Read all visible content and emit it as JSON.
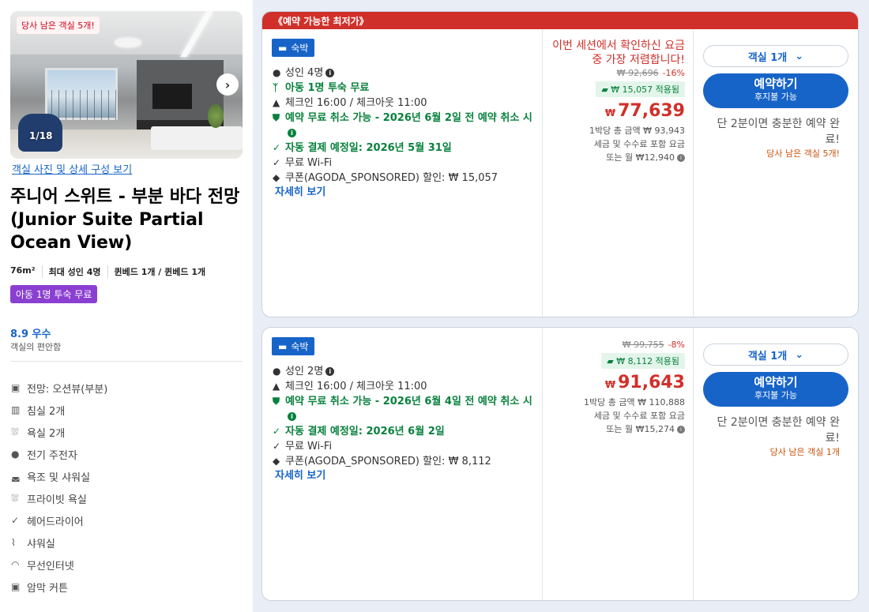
{
  "room": {
    "photo_badge": "당사 남은 객실 5개!",
    "photo_counter": "1/18",
    "gallery_link": "객실 사진 및 상세 구성 보기",
    "title": "주니어 스위트 - 부분 바다 전망 (Junior Suite Partial Ocean View)",
    "specs": [
      "76m²",
      "최대 성인 4명",
      "퀸베드 1개 / 퀸베드 1개"
    ],
    "promo_tag": "아동 1명 투숙 무료",
    "rating_score": "8.9 우수",
    "rating_sub": "객실의 편안함",
    "features": [
      {
        "icon": "view-icon",
        "glyph": "▣",
        "label": "전망: 오션뷰(부분)"
      },
      {
        "icon": "bedroom-icon",
        "glyph": "▥",
        "label": "침실 2개"
      },
      {
        "icon": "bath-icon",
        "glyph": "⛆",
        "label": "욕실 2개"
      },
      {
        "icon": "kettle-icon",
        "glyph": "●",
        "label": "전기 주전자"
      },
      {
        "icon": "bathtub-icon",
        "glyph": "◛",
        "label": "욕조 및 샤워실"
      },
      {
        "icon": "private-bath-icon",
        "glyph": "⛆",
        "label": "프라이빗 욕실"
      },
      {
        "icon": "check-icon",
        "glyph": "✓",
        "label": "헤어드라이어"
      },
      {
        "icon": "shower-icon",
        "glyph": "⌇",
        "label": "샤워실"
      },
      {
        "icon": "wifi-icon",
        "glyph": "◠",
        "label": "무선인터넷"
      },
      {
        "icon": "blackout-icon",
        "glyph": "▣",
        "label": "암막 커튼"
      }
    ]
  },
  "offers": [
    {
      "banner": "《예약 가능한 최저가》",
      "stay_tag": "숙박",
      "occupancy": "성인 4명",
      "kids_free": "아동 1명 투숙 무료",
      "checkin": "체크인 16:00 / 체크아웃 11:00",
      "cancel": "예약 무료 취소 가능 - 2026년 6월 2일 전 예약 취소 시",
      "autopay": "자동 결제 예정일: 2026년 5월 31일",
      "wifi": "무료 Wi-Fi",
      "coupon": "쿠폰(AGODA_SPONSORED) 할인: ₩ 15,057",
      "detail_link": "자세히 보기",
      "lowest_msg": "이번 세션에서 확인하신 요금 중 가장 저렴합니다!",
      "original_price": "₩ 92,696",
      "discount": "-16%",
      "coupon_applied": "₩ 15,057 적용됨",
      "currency": "₩",
      "price": "77,639",
      "night_total": "1박당 총 금액 ₩ 93,943",
      "tax_note": "세금 및 수수료 포함 요금",
      "monthly": "또는 월 ₩12,940",
      "room_select": "객실 1개",
      "book_label": "예약하기",
      "pay_later": "후지불 가능",
      "quick_msg": "단 2분이면 충분한 예약 완료!",
      "rooms_left": "당사 남은 객실 5개!"
    },
    {
      "stay_tag": "숙박",
      "occupancy": "성인 2명",
      "checkin": "체크인 16:00 / 체크아웃 11:00",
      "cancel": "예약 무료 취소 가능 - 2026년 6월 4일 전 예약 취소 시",
      "autopay": "자동 결제 예정일: 2026년 6월 2일",
      "wifi": "무료 Wi-Fi",
      "coupon": "쿠폰(AGODA_SPONSORED) 할인: ₩ 8,112",
      "detail_link": "자세히 보기",
      "original_price": "₩ 99,755",
      "discount": "-8%",
      "coupon_applied": "₩ 8,112 적용됨",
      "currency": "₩",
      "price": "91,643",
      "night_total": "1박당 총 금액 ₩ 110,888",
      "tax_note": "세금 및 수수료 포함 요금",
      "monthly": "또는 월 ₩15,274",
      "room_select": "객실 1개",
      "book_label": "예약하기",
      "pay_later": "후지불 가능",
      "quick_msg": "단 2분이면 충분한 예약 완료!",
      "rooms_left": "당사 남은 객실 1개"
    }
  ]
}
